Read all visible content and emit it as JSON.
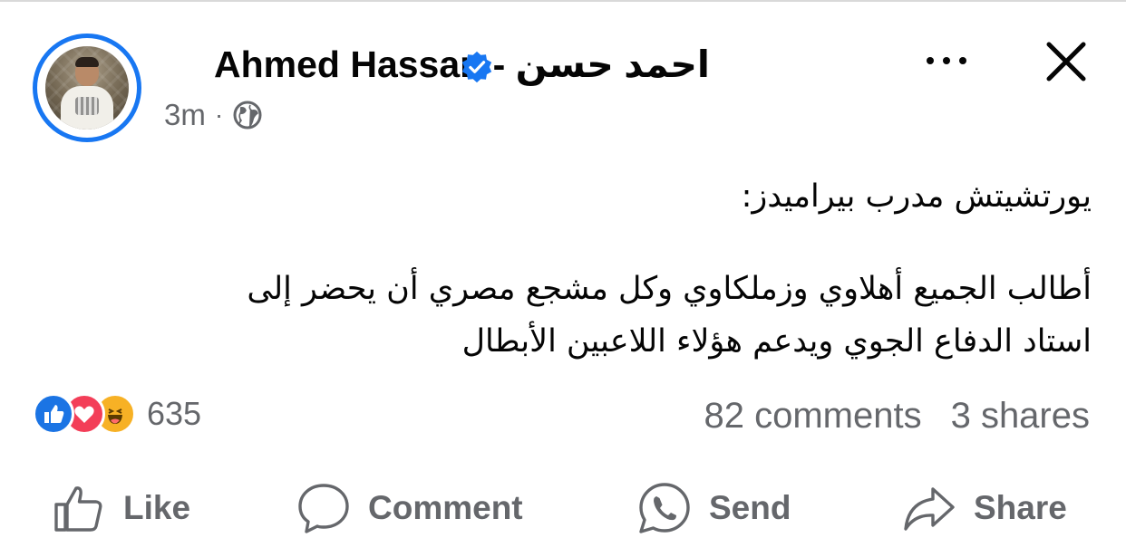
{
  "post": {
    "author": "Ahmed Hassan - احمد حسن",
    "time": "3m",
    "separator": "·",
    "lines": [
      "يورتشيتش مدرب بيراميدز:",
      "",
      "أطالب الجميع أهلاوي وزملكاوي وكل مشجع مصري أن يحضر إلى",
      "استاد الدفاع الجوي ويدعم هؤلاء اللاعبين الأبطال"
    ]
  },
  "reactions": {
    "count": "635",
    "icons": [
      "like-reaction-icon",
      "love-reaction-icon",
      "haha-reaction-icon"
    ]
  },
  "stats": {
    "comments": "82 comments",
    "shares": "3 shares"
  },
  "actions": {
    "like": "Like",
    "comment": "Comment",
    "send": "Send",
    "share": "Share"
  },
  "colors": {
    "accent": "#1877f2",
    "secondary_text": "#65676b",
    "love": "#f33e58",
    "haha": "#f7b125"
  }
}
